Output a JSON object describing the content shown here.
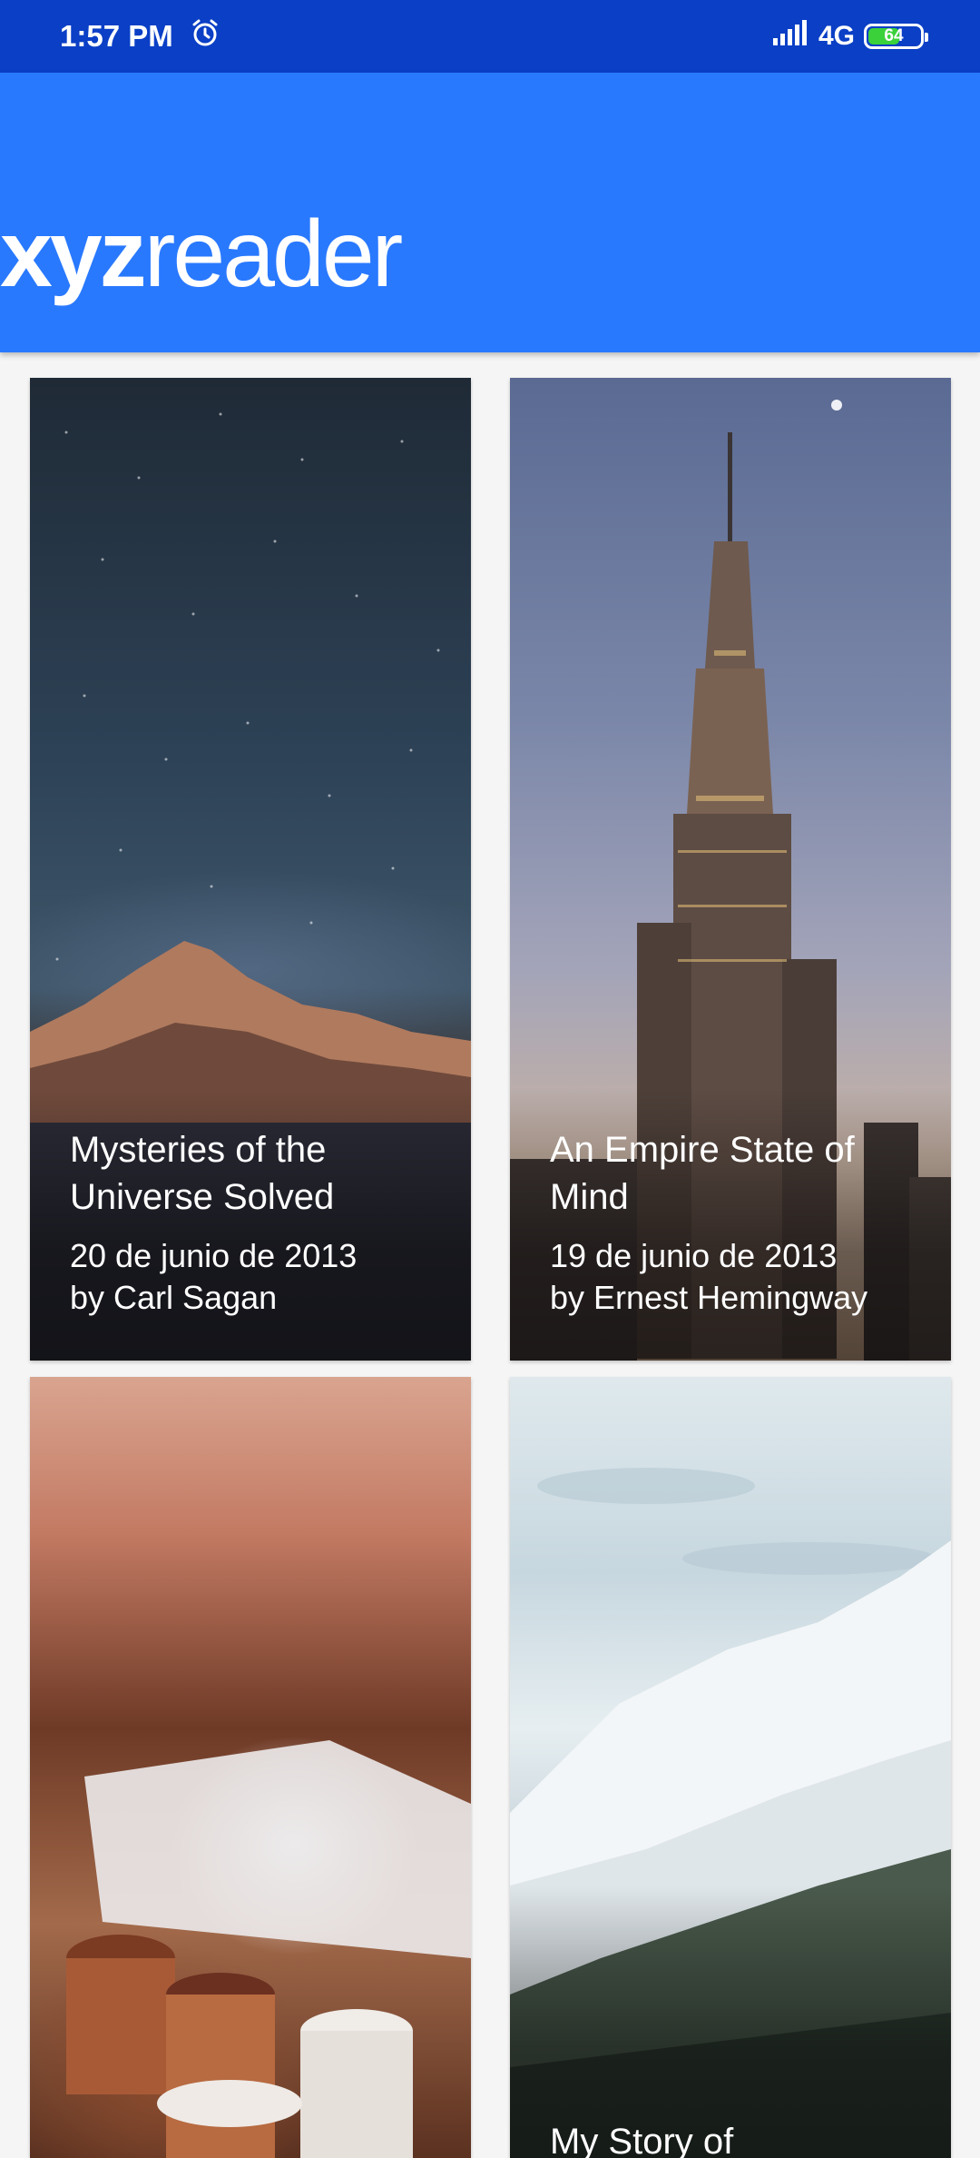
{
  "status_bar": {
    "time": "1:57 PM",
    "alarm_icon": "alarm-clock-icon",
    "signal_icon": "cell-signal-icon",
    "network": "4G",
    "battery_level": "64",
    "battery_color": "#3bd13b"
  },
  "app_bar": {
    "logo_bold": "xyz",
    "logo_light": "reader",
    "color": "#2979ff"
  },
  "articles": [
    {
      "title": "Mysteries of the Universe Solved",
      "date": "20 de junio de 2013",
      "author": "by Carl Sagan"
    },
    {
      "title": "An Empire State of Mind",
      "date": "19 de junio de 2013",
      "author": "by Ernest Hemingway"
    },
    {
      "title": "",
      "date": "",
      "author": ""
    },
    {
      "title": "My Story of",
      "date": "",
      "author": ""
    }
  ]
}
